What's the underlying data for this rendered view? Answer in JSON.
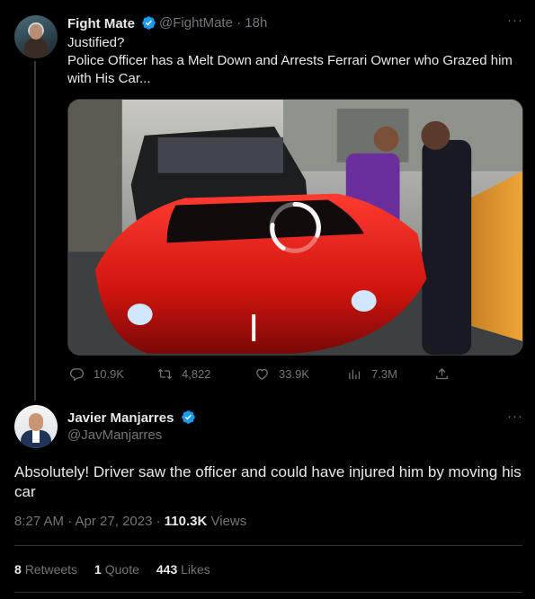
{
  "original_tweet": {
    "author_name": "Fight Mate",
    "author_handle": "@FightMate",
    "time": "18h",
    "separator": "·",
    "more": "···",
    "text_line1": "Justified?",
    "text_line2": "Police Officer has a Melt Down and Arrests Ferrari Owner who Grazed him with His Car...",
    "media_description": "video",
    "actions": {
      "replies": "10.9K",
      "retweets": "4,822",
      "likes": "33.9K",
      "views": "7.3M"
    }
  },
  "reply": {
    "author_name": "Javier Manjarres",
    "author_handle": "@JavManjarres",
    "more": "···",
    "text": "Absolutely! Driver saw the officer and could have injured him by moving his car",
    "timestamp": "8:27 AM · Apr 27, 2023 · ",
    "views_count": "110.3K",
    "views_label": " Views",
    "stats": {
      "retweets_count": "8",
      "retweets_label": "Retweets",
      "quotes_count": "1",
      "quotes_label": "Quote",
      "likes_count": "443",
      "likes_label": "Likes"
    }
  },
  "colors": {
    "background": "#000000",
    "text_primary": "#e7e9ea",
    "text_secondary": "#71767b",
    "verified_blue": "#1d9bf0",
    "divider": "#2f3336"
  }
}
